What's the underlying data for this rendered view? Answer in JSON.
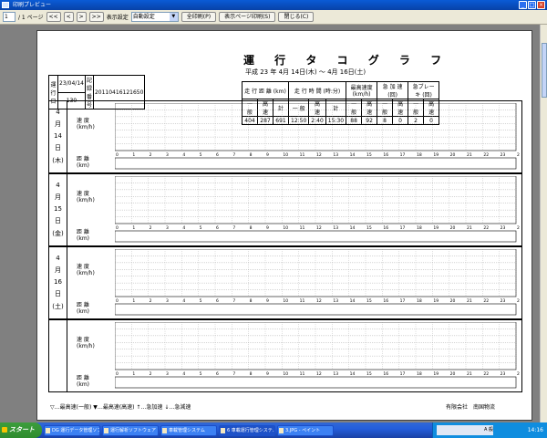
{
  "window": {
    "title": "印刷プレビュー"
  },
  "toolbar": {
    "page_value": "1",
    "page_total": "/ 1 ページ",
    "nav": [
      "<<",
      "<",
      ">",
      ">>"
    ],
    "display_label": "表示設定",
    "display_value": "自動設定",
    "print_all": "全印刷(P)",
    "print_page": "表示ページ印刷(S)",
    "close": "閉じる(C)"
  },
  "document": {
    "title": "運 行 タ コ グ ラ フ",
    "subtitle": "平成 23 年  4月 14日(木) ～  4月 16日(土)",
    "operation_date_label": "運行日",
    "operation_date": "23/04/14",
    "vehicle_label": "車番",
    "vehicle": "130",
    "record_no": "20110416121650",
    "record_label": "記録番号",
    "stats_headers": {
      "distance": "走 行 距 離 (km)",
      "time": "走 行 時 間 (時:分)",
      "maxspeed": "最高速度 (km/h)",
      "accel": "急 加 速 (回)",
      "brake": "急ブレーキ (回)"
    },
    "stats_sub": [
      "一 般",
      "高 速",
      "計",
      "一 般",
      "高 速",
      "計",
      "一 般",
      "高 速",
      "一 般",
      "高 速",
      "一 般",
      "高 速"
    ],
    "stats_values": [
      "404",
      "287",
      "691",
      "12:50",
      "2:40",
      "15:30",
      "88",
      "92",
      "8",
      "0",
      "2",
      "0"
    ],
    "speed_label": "速 度",
    "speed_unit": "(km/h)",
    "distance_label": "距 離",
    "distance_unit": "(km)",
    "days": [
      {
        "month": "4",
        "day": "14",
        "weekday": "(木)"
      },
      {
        "month": "4",
        "day": "15",
        "weekday": "(金)"
      },
      {
        "month": "4",
        "day": "16",
        "weekday": "(土)"
      },
      {
        "month": "",
        "day": "",
        "weekday": ""
      }
    ],
    "legend": "▽…最高速(一般) ▼…最高速(高速) ↑…急加速 ↓…急減速",
    "company": "有限会社　南国物流"
  },
  "taskbar": {
    "start": "スタート",
    "tasks": [
      "DG 運行データ管理ソフト",
      "運行解析ソフトウェア",
      "車載管理システム",
      "6 車載運行管理システ...",
      "3.JPG - ペイント"
    ],
    "ime": "A 般 ",
    "clock": "14:16"
  }
}
